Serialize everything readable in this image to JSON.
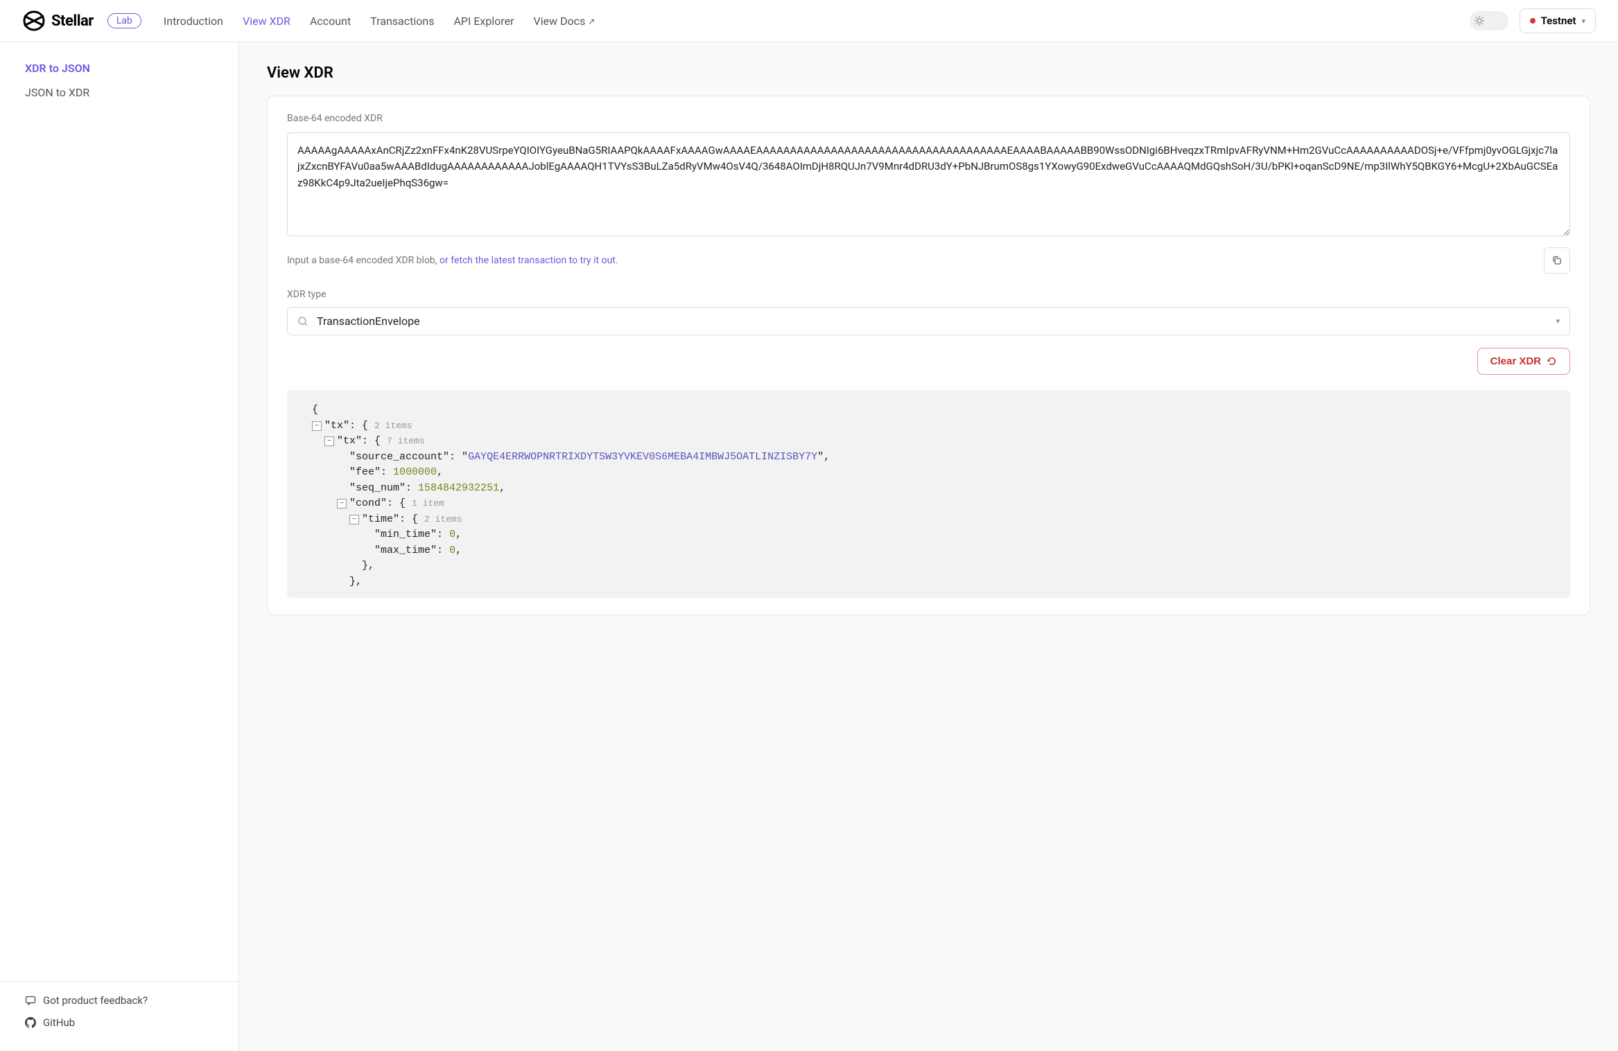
{
  "header": {
    "logo_text": "Stellar",
    "lab_badge": "Lab",
    "nav": {
      "introduction": "Introduction",
      "view_xdr": "View XDR",
      "account": "Account",
      "transactions": "Transactions",
      "api_explorer": "API Explorer",
      "view_docs": "View Docs"
    },
    "network_label": "Testnet"
  },
  "sidebar": {
    "xdr_to_json": "XDR to JSON",
    "json_to_xdr": "JSON to XDR",
    "feedback": "Got product feedback?",
    "github": "GitHub"
  },
  "page": {
    "title": "View XDR",
    "field_label": "Base-64 encoded XDR",
    "xdr_value": "AAAAAgAAAAAxAnCRjZz2xnFFx4nK28VUSrpeYQIOIYGyeuBNaG5RIAAPQkAAAAFxAAAAGwAAAAEAAAAAAAAAAAAAAAAAAAAAAAAAAAAAAAAAAAAAEAAAABAAAAABB90WssODNIgi6BHveqzxTRmIpvAFRyVNM+Hm2GVuCcAAAAAAAAAADOSj+e/VFfpmj0yvOGLGjxjc7lajxZxcnBYFAVu0aa5wAAABdIdugAAAAAAAAAAAAJoblEgAAAAQH1TVYsS3BuLZa5dRyVMw4OsV4Q/3648AOImDjH8RQUJn7V9Mnr4dDRU3dY+PbNJBrumOS8gs1YXowyG90ExdweGVuCcAAAAQMdGQshSoH/3U/bPKl+oqanScD9NE/mp3IlWhY5QBKGY6+McgU+2XbAuGCSEaz98KkC4p9Jta2ueIjePhqS36gw=",
    "hint_prefix": "Input a base-64 encoded XDR blob, ",
    "hint_link": "or fetch the latest transaction to try it out.",
    "xdr_type_label": "XDR type",
    "xdr_type_value": "TransactionEnvelope",
    "clear_label": "Clear XDR"
  },
  "json": {
    "open": "{",
    "tx_key": "\"tx\"",
    "two_items": "2 items",
    "seven_items": "7 items",
    "one_item": "1 item",
    "source_account_key": "\"source_account\"",
    "source_account_val": "GAYQE4ERRWOPNRTRIXDYTSW3YVKEV0S6MEBA4IMBWJ5OATLINZISBY7Y",
    "fee_key": "\"fee\"",
    "fee_val": "1000000",
    "seq_num_key": "\"seq_num\"",
    "seq_num_val": "1584842932251",
    "cond_key": "\"cond\"",
    "time_key": "\"time\"",
    "min_time_key": "\"min_time\"",
    "max_time_key": "\"max_time\"",
    "zero": "0",
    "close_brace_comma": "},"
  }
}
